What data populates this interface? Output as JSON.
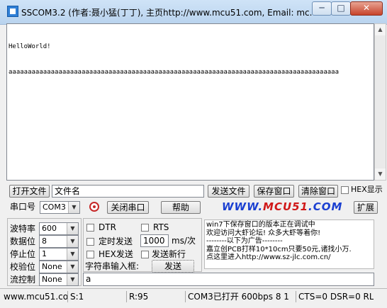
{
  "window": {
    "title": "SSCOM3.2 (作者:聂小猛(丁丁), 主页http://www.mcu51.com,  Email: mc...",
    "minimize_label": "─",
    "maximize_label": "□",
    "close_label": "✕"
  },
  "receive": {
    "lines": [
      "HelloWorld!",
      "aaaaaaaaaaaaaaaaaaaaaaaaaaaaaaaaaaaaaaaaaaaaaaaaaaaaaaaaaaaaaaaaaaaaaaaaaaaaaaaaaaaaaa"
    ]
  },
  "file_row": {
    "open_file_label": "打开文件",
    "file_name_value": "文件名",
    "send_file_label": "发送文件",
    "save_window_label": "保存窗口",
    "clear_window_label": "清除窗口",
    "hex_display_label": "HEX显示"
  },
  "port_row": {
    "port_label": "串口号",
    "port_value": "COM3",
    "close_port_label": "关闭串口",
    "help_label": "帮助",
    "site_logo_prefix": "WWW.",
    "site_logo_brand": "MCU51",
    "site_logo_suffix": ".COM",
    "extend_label": "扩展"
  },
  "settings": {
    "baud_label": "波特率",
    "baud_value": "600",
    "data_bits_label": "数据位",
    "data_bits_value": "8",
    "stop_bits_label": "停止位",
    "stop_bits_value": "1",
    "parity_label": "校验位",
    "parity_value": "None",
    "flow_label": "流控制",
    "flow_value": "None"
  },
  "options": {
    "dtr_label": "DTR",
    "rts_label": "RTS",
    "timed_send_label": "定时发送",
    "interval_value": "1000",
    "interval_unit": "ms/次",
    "hex_send_label": "HEX发送",
    "send_newline_label": "发送新行",
    "input_box_label": "字符串输入框:",
    "send_button_label": "发送",
    "send_text_value": "a"
  },
  "ad": {
    "lines": [
      "win7下保存窗口的版本正在调试中",
      "欢迎访问大虾论坛! 众多大虾等着你!",
      "--------以下为广告--------",
      "嘉立创PCB打样10*10cm只要50元,诸找小万.",
      "点这里进入http://www.sz-jlc.com.cn/"
    ]
  },
  "status": {
    "site": "www.mcu51.cor",
    "sent": "S:1",
    "received": "R:95",
    "port_status": "COM3已打开  600bps  8 1",
    "line_status": "CTS=0 DSR=0 RL"
  },
  "colors": {
    "accent": "#1a3fd1",
    "brand_red": "#d01818"
  }
}
